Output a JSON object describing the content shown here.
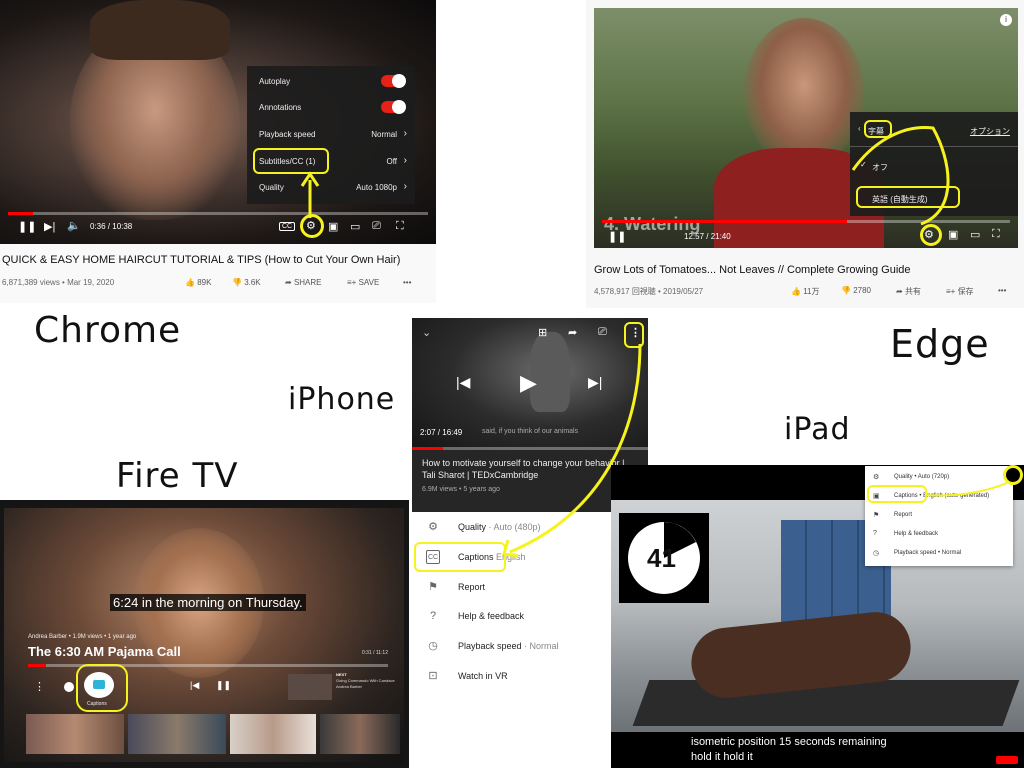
{
  "labels": {
    "chrome": "Chrome",
    "edge": "Edge",
    "iphone": "iPhone",
    "ipad": "iPad",
    "firetv": "Fire TV"
  },
  "chrome": {
    "menu": [
      {
        "label": "Autoplay",
        "toggle": true
      },
      {
        "label": "Annotations",
        "toggle": true
      },
      {
        "label": "Playback speed",
        "value": "Normal"
      },
      {
        "label": "Subtitles/CC (1)",
        "value": "Off"
      },
      {
        "label": "Quality",
        "value": "Auto 1080p"
      }
    ],
    "time": "0:36 / 10:38",
    "progress_fraction": 0.06,
    "title": "QUICK & EASY HOME HAIRCUT TUTORIAL & TIPS (How to Cut Your Own Hair)",
    "meta": "6,871,389 views • Mar 19, 2020",
    "likes": "89K",
    "dislikes": "3.6K",
    "share": "SHARE",
    "save": "SAVE",
    "more": "•••"
  },
  "edge": {
    "menu_header": "字幕",
    "menu_option": "オプション",
    "menu_items": [
      "オフ",
      "英語 (自動生成)"
    ],
    "overlay_text": "4. Watering",
    "time": "12:57 / 21:40",
    "progress_fraction": 0.6,
    "title": "Grow Lots of Tomatoes... Not Leaves // Complete Growing Guide",
    "meta": "4,578,917 回視聴 • 2019/05/27",
    "likes": "11万",
    "dislikes": "2780",
    "share": "共有",
    "save": "保存",
    "more": "•••"
  },
  "iphone": {
    "time": "2:07 / 16:49",
    "overlay_caption": "said, if you think of our animals",
    "progress_fraction": 0.13,
    "title": "How to motivate yourself to change your behavior | Tali Sharot | TEDxCambridge",
    "meta": "6.9M views • 5 years ago",
    "menu": [
      {
        "icon": "gear-icon",
        "label": "Quality",
        "sub": " · Auto (480p)"
      },
      {
        "icon": "captions-icon",
        "label": "Captions",
        "sub": " English"
      },
      {
        "icon": "flag-icon",
        "label": "Report",
        "sub": ""
      },
      {
        "icon": "help-icon",
        "label": "Help & feedback",
        "sub": ""
      },
      {
        "icon": "playback-speed-icon",
        "label": "Playback speed",
        "sub": " · Normal"
      },
      {
        "icon": "vr-icon",
        "label": "Watch in VR",
        "sub": ""
      }
    ]
  },
  "firetv": {
    "caption_time": "6:24",
    "caption_text": " in the morning on Thursday.",
    "channel": "Andrea Barber • 1.9M views • 1 year ago",
    "title": "The 6:30 AM Pajama Call",
    "duration": "0:31 / 11:12",
    "progress_fraction": 0.05,
    "captions_label": "Captions",
    "next_label": "NEXT",
    "next_title": "Going Commando With Candace",
    "next_channel": "Andrea Barber"
  },
  "ipad": {
    "counter": "41",
    "menu": [
      {
        "label": "Quality • Auto (720p)"
      },
      {
        "label": "Captions • English (auto-generated)"
      },
      {
        "label": "Report"
      },
      {
        "label": "Help & feedback"
      },
      {
        "label": "Playback speed • Normal"
      }
    ],
    "caption_line1": "isometric position 15 seconds remaining",
    "caption_line2": "hold it hold it"
  },
  "colors": {
    "highlight": "#f5f21d",
    "youtube_red": "#ff0000"
  }
}
